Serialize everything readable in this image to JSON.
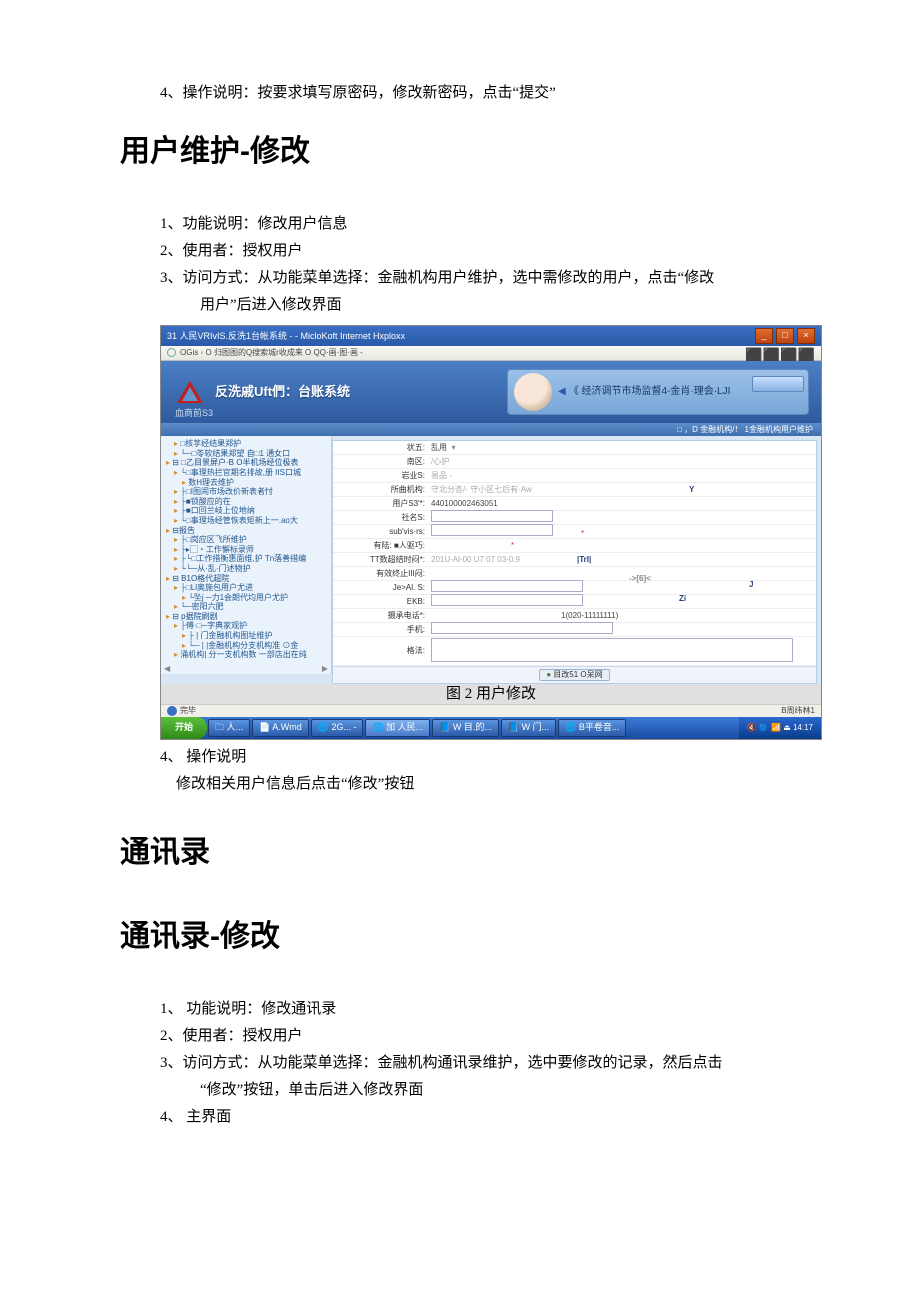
{
  "top_line": "4、操作说明：按要求填写原密码，修改新密码，点击“提交”",
  "h_user_modify": "用户维护-修改",
  "um": {
    "l1": "1、功能说明：修改用户信息",
    "l2": "2、使用者：授权用户",
    "l3a": "3、访问方式：从功能菜单选择：金融机构用户维护，选中需修改的用户，点击“修改",
    "l3b": "用户”后进入修改界面",
    "l4": "4、 操作说明",
    "l4b": "修改相关用户信息后点击“修改”按钮"
  },
  "h_contacts": "通讯录",
  "h_contacts_modify": "通讯录-修改",
  "cm": {
    "l1": "1、 功能说明：修改通讯录",
    "l2": "2、使用者：授权用户",
    "l3a": "3、访问方式：从功能菜单选择：金融机构通讯录维护，选中要修改的记录，然后点击",
    "l3b": "“修改”按钮，单击后进入修改界面",
    "l4": "4、 主界面"
  },
  "shot": {
    "title": "31 人民VRIvIS.反洗1台帐系统 - - MicloKoft Internet Hxploxx",
    "toolbar": "OGis ◦ O 归图图的Q搜索城r收成来 O QQ·画·图·画 -",
    "banner_title": "反洗戚Uft們：台账系统",
    "banner_sub": "血商前S3",
    "banner_right": "《 经济调节市场监督4-金肖·理会·LJI",
    "subbar": "□ ，D 金融机构/！     1金融机构用户维护",
    "tree": [
      {
        "cls": "n1",
        "txt": "□核苸经结果郑护"
      },
      {
        "cls": "n1",
        "txt": "└─□苓软结果郑望 自□1 通女口"
      },
      {
        "cls": "n0",
        "txt": "⊟ □乙目景屏户·B O半机场经位极表"
      },
      {
        "cls": "n1",
        "txt": "└□事理热拦官期名排故,册 IIS口城"
      },
      {
        "cls": "n2",
        "txt": "数H理去维护"
      },
      {
        "cls": "n1",
        "txt": "├□I图闹市场改价新表者忖"
      },
      {
        "cls": "n1",
        "txt": "├■锁酸应的在"
      },
      {
        "cls": "n1",
        "txt": "├■口回兰岐上位地纳"
      },
      {
        "cls": "n1",
        "txt": "└□事理场经管恢表矩新上一.ao大"
      },
      {
        "cls": "n0",
        "txt": "⊟报告"
      },
      {
        "cls": "n1",
        "txt": "├□岗应区飞所维护"
      },
      {
        "cls": "n1",
        "txt": "├▸▢・工作懈标录师"
      },
      {
        "cls": "n1",
        "txt": "├└□工作措衡惠面维,护 Tn落善措编"
      },
      {
        "cls": "n1",
        "txt": "└└─从·乱·门述物护"
      },
      {
        "cls": "n0",
        "txt": "⊟ B1O格代超院"
      },
      {
        "cls": "n1",
        "txt": "├□Ll奥施包用户尤进"
      },
      {
        "cls": "n2",
        "txt": "└坠j ─力1会朗代均用户尤护"
      },
      {
        "cls": "n1",
        "txt": "└─密阳六肥"
      },
      {
        "cls": "n0",
        "txt": "⊟ p据院刷剧"
      },
      {
        "cls": "n1",
        "txt": "├傅·□─字典家观护"
      },
      {
        "cls": "n2",
        "txt": "├ | 门金融机构图址维护"
      },
      {
        "cls": "n2",
        "txt": "└─ | |金融机构分支机构准 ⊙金"
      },
      {
        "cls": "n1",
        "txt": "涌机构| 分一支机构数 一部店出在纯"
      }
    ],
    "form": {
      "f_status_l": "状五:",
      "f_status_v": "乱用",
      "f_region_l": "南区:",
      "f_region_v": "/心护",
      "f_biz_l": "岩业S:",
      "f_biz_v": "易品   -",
      "f_org_l": "所曲机构:",
      "f_org_v": "守北分杏/- 守小区七后有·Aw",
      "f_uid_l": "用户S3'*:",
      "f_uid_v": "440100002463051",
      "f_comp_l": "社名S:",
      "f_comp_v": "",
      "f_code_l": "sub'vis·rs:",
      "f_code_v": "",
      "f_role_l": "有陆: ■人驱巧:",
      "f_tt_l": "TT数超结时闷*:",
      "f_tt_v": "201U-Al-00 U7 07 03-0.9",
      "f_tt_tag": "|TrI|",
      "f_valid_l": "有效终止III闷:",
      "f_valid_tag": "->[6]<",
      "f_jal_l": "Je>Al. S:",
      "f_ekb_l": "EKB:",
      "f_ekb_tag": "Zi",
      "f_tel_l": "摄承电话*:",
      "f_tel_v": "1(020-11111111)",
      "f_mob_l": "手机:",
      "f_remark_l": "格法:"
    },
    "submit_btn": "目改51 O呆网",
    "caption": "图 2 用户修改",
    "status_done": "完毕",
    "status_right": "B周纬林1",
    "start": "开始",
    "tasks": [
      "🗀 人...",
      "📄 A.Wmd",
      "🌐 2G... -",
      "🌐 加 人民...",
      "📘 W 目.的...",
      "📘 W 门...",
      "🌐 B平卷音..."
    ],
    "tray": "🔇 🔵 📶 ⏏  14:17"
  }
}
